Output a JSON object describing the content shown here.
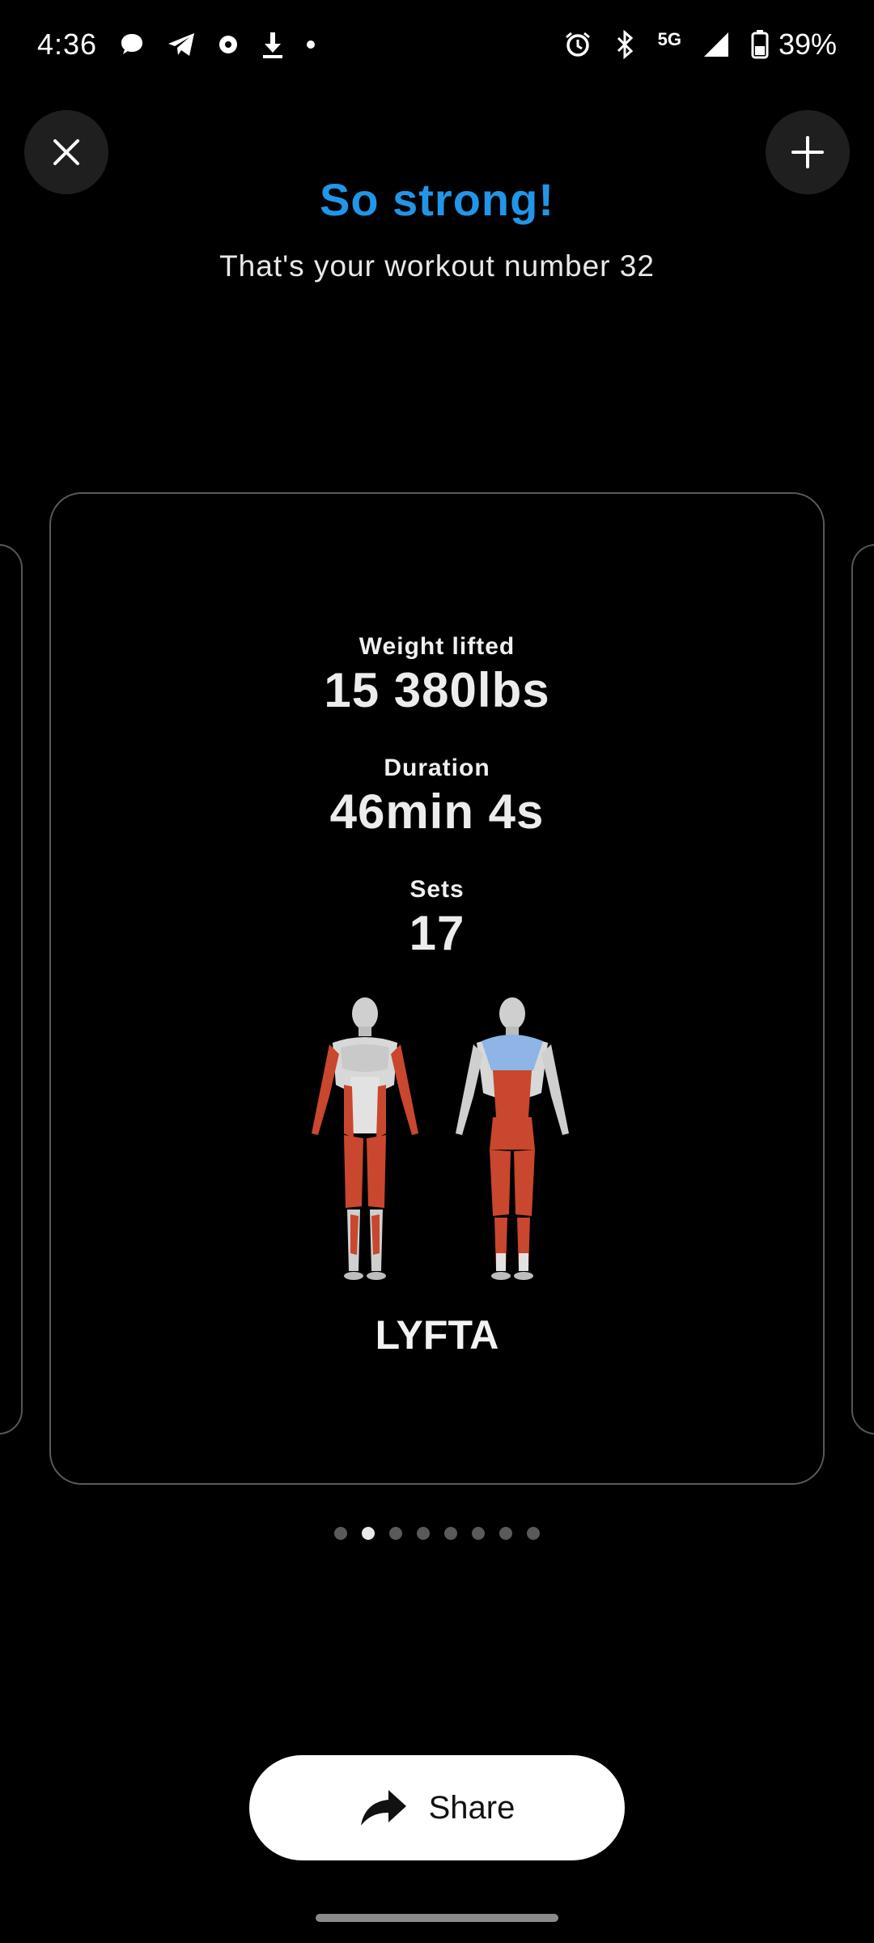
{
  "status_bar": {
    "time": "4:36",
    "network": "5G",
    "battery": "39%",
    "left_icons": [
      "chat-bubble-icon",
      "telegram-icon",
      "settings-gear-icon",
      "download-icon",
      "dot-icon"
    ],
    "right_icons": [
      "alarm-icon",
      "bluetooth-icon",
      "signal-icon",
      "battery-icon"
    ]
  },
  "header": {
    "title": "So strong!",
    "subtitle": "That's your workout number 32",
    "title_color": "#2196e8"
  },
  "card": {
    "stats": [
      {
        "label": "Weight lifted",
        "value": "15 380lbs"
      },
      {
        "label": "Duration",
        "value": "46min 4s"
      },
      {
        "label": "Sets",
        "value": "17"
      }
    ],
    "brand": "LYFTA",
    "muscle_colors": {
      "trained": "#c8472e",
      "highlight": "#8fb4e6",
      "base": "#cfcfcf"
    }
  },
  "pager": {
    "count": 8,
    "active_index": 1
  },
  "share_button": {
    "label": "Share"
  }
}
